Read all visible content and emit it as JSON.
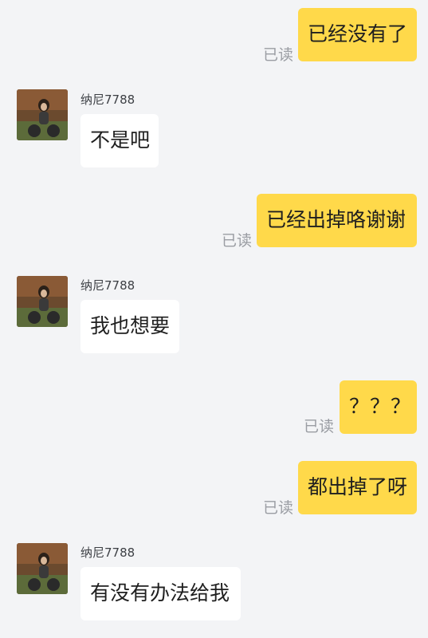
{
  "read_label": "已读",
  "messages": [
    {
      "side": "out",
      "text": "已经没有了"
    },
    {
      "side": "in",
      "sender": "纳尼7788",
      "text": "不是吧"
    },
    {
      "side": "out",
      "text": "已经出掉咯谢谢"
    },
    {
      "side": "in",
      "sender": "纳尼7788",
      "text": "我也想要"
    },
    {
      "side": "out",
      "text": "？？？"
    },
    {
      "side": "out",
      "text": "都出掉了呀"
    },
    {
      "side": "in",
      "sender": "纳尼7788",
      "text": "有没有办法给我"
    }
  ],
  "colors": {
    "background": "#f3f4f6",
    "outgoing_bubble": "#ffd94a",
    "incoming_bubble": "#ffffff",
    "read_text": "#9a9da3"
  },
  "icons": {
    "avatar": "user-avatar-photo"
  }
}
